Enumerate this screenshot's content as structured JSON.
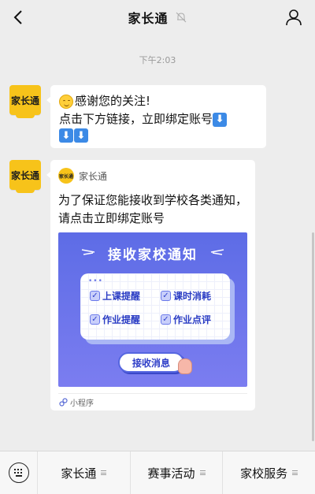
{
  "header": {
    "title": "家长通",
    "back_icon": "chevron-left-icon",
    "mute_icon": "bell-muted-icon",
    "user_icon": "user-icon"
  },
  "timestamp": "下午2:03",
  "sender": {
    "avatar_text": "家长通"
  },
  "message1": {
    "line1": "感谢您的关注!",
    "line2": "点击下方链接，立即绑定账号",
    "arrow_symbol": "⬇"
  },
  "mini_program": {
    "logo_text": "家长通",
    "name": "家长通",
    "description": "为了保证您能接收到学校各类通知，请点击立即绑定账号",
    "banner": {
      "title": "接收家校通知",
      "dots": "•••",
      "features": [
        "上课提醒",
        "课时消耗",
        "作业提醒",
        "作业点评"
      ],
      "button": "接收消息"
    },
    "footer_label": "小程序"
  },
  "bottom_menu": {
    "keyboard_icon": "keyboard-icon",
    "items": [
      "家长通",
      "赛事活动",
      "家校服务"
    ]
  },
  "colors": {
    "background": "#ededed",
    "brand_yellow": "#f7c31a",
    "banner_blue": "#5d6ce6",
    "arrow_blue": "#3c8ae6"
  }
}
